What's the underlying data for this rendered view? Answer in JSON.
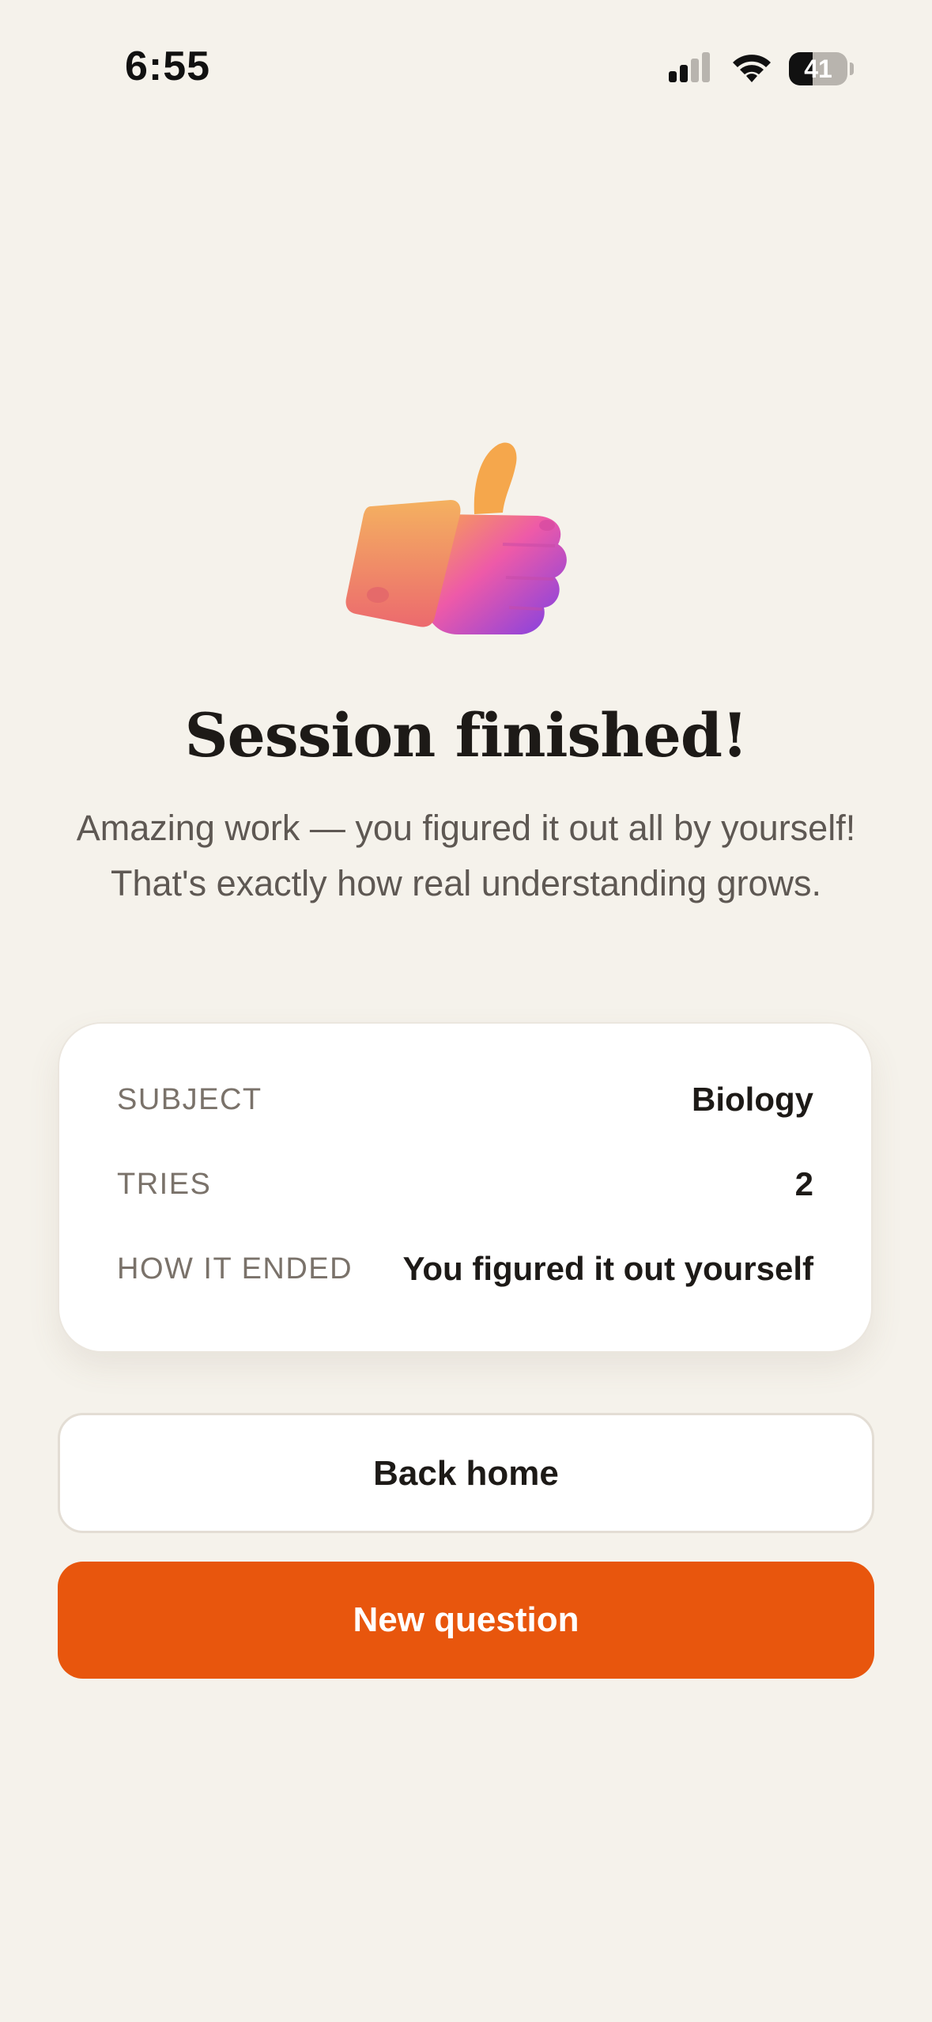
{
  "status_bar": {
    "time": "6:55",
    "battery_level": "41",
    "battery_fraction": 0.41
  },
  "hero": {
    "icon": "thumbs-up-icon"
  },
  "heading": {
    "title": "Session finished!",
    "message": "Amazing work — you figured it out all by yourself! That's exactly how real understanding grows."
  },
  "summary": {
    "rows": [
      {
        "label": "SUBJECT",
        "value": "Biology"
      },
      {
        "label": "TRIES",
        "value": "2"
      },
      {
        "label": "HOW IT ENDED",
        "value": "You figured it out yourself"
      }
    ]
  },
  "actions": {
    "back_home_label": "Back home",
    "new_question_label": "New question"
  },
  "colors": {
    "background": "#f5f2eb",
    "accent": "#e8560d",
    "card": "#ffffff",
    "text_primary": "#1d1a17",
    "text_muted": "#7a726a"
  }
}
